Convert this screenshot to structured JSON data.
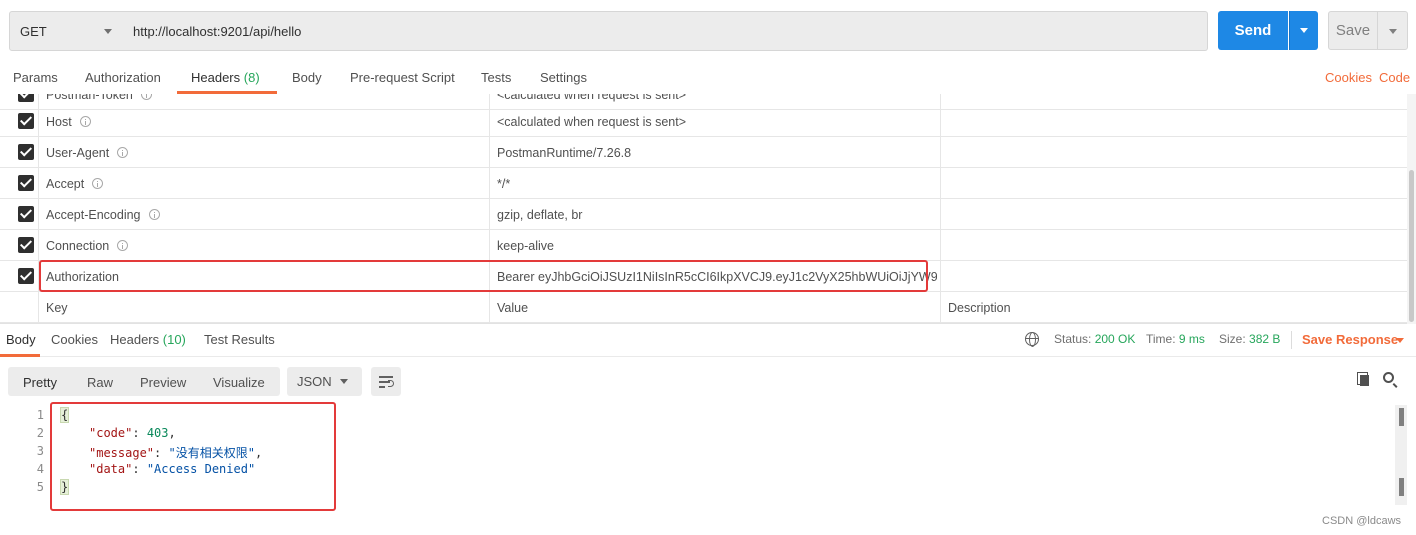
{
  "request": {
    "method": "GET",
    "url": "http://localhost:9201/api/hello",
    "send_label": "Send",
    "save_label": "Save"
  },
  "request_tabs": [
    {
      "label": "Params"
    },
    {
      "label": "Authorization"
    },
    {
      "label": "Headers",
      "count": "(8)"
    },
    {
      "label": "Body"
    },
    {
      "label": "Pre-request Script"
    },
    {
      "label": "Tests"
    },
    {
      "label": "Settings"
    }
  ],
  "request_links": {
    "cookies": "Cookies",
    "code": "Code"
  },
  "headers_table": {
    "rows": [
      {
        "key": "Postman-Token",
        "value": "<calculated when request is sent>",
        "checked": true,
        "info": true
      },
      {
        "key": "Host",
        "value": "<calculated when request is sent>",
        "checked": true,
        "info": true
      },
      {
        "key": "User-Agent",
        "value": "PostmanRuntime/7.26.8",
        "checked": true,
        "info": true
      },
      {
        "key": "Accept",
        "value": "*/*",
        "checked": true,
        "info": true
      },
      {
        "key": "Accept-Encoding",
        "value": "gzip, deflate, br",
        "checked": true,
        "info": true
      },
      {
        "key": "Connection",
        "value": "keep-alive",
        "checked": true,
        "info": true
      },
      {
        "key": "Authorization",
        "value": "Bearer eyJhbGciOiJSUzI1NiIsInR5cCI6IkpXVCJ9.eyJ1c2VyX25hbWUiOiJjYW9",
        "checked": true,
        "info": false
      }
    ],
    "placeholders": {
      "key": "Key",
      "value": "Value",
      "description": "Description"
    }
  },
  "response_tabs": [
    {
      "label": "Body"
    },
    {
      "label": "Cookies"
    },
    {
      "label": "Headers",
      "count": "(10)"
    },
    {
      "label": "Test Results"
    }
  ],
  "response_status": {
    "status_label": "Status:",
    "status_value": "200 OK",
    "time_label": "Time:",
    "time_value": "9 ms",
    "size_label": "Size:",
    "size_value": "382 B",
    "save_response": "Save Response"
  },
  "body_format": {
    "buttons": [
      "Pretty",
      "Raw",
      "Preview",
      "Visualize"
    ],
    "language": "JSON"
  },
  "response_body": {
    "line_numbers": [
      "1",
      "2",
      "3",
      "4",
      "5"
    ],
    "open_brace": "{",
    "close_brace": "}",
    "entries": [
      {
        "key": "\"code\"",
        "value": "403",
        "type": "number",
        "trail": ","
      },
      {
        "key": "\"message\"",
        "value": "\"没有相关权限\"",
        "type": "string",
        "trail": ","
      },
      {
        "key": "\"data\"",
        "value": "\"Access Denied\"",
        "type": "string",
        "trail": ""
      }
    ]
  },
  "watermark": "CSDN @ldcaws",
  "colors": {
    "accent": "#f26b3a",
    "primary": "#1e88e5",
    "success": "#26a65b",
    "highlight_box": "#e33a3a"
  }
}
